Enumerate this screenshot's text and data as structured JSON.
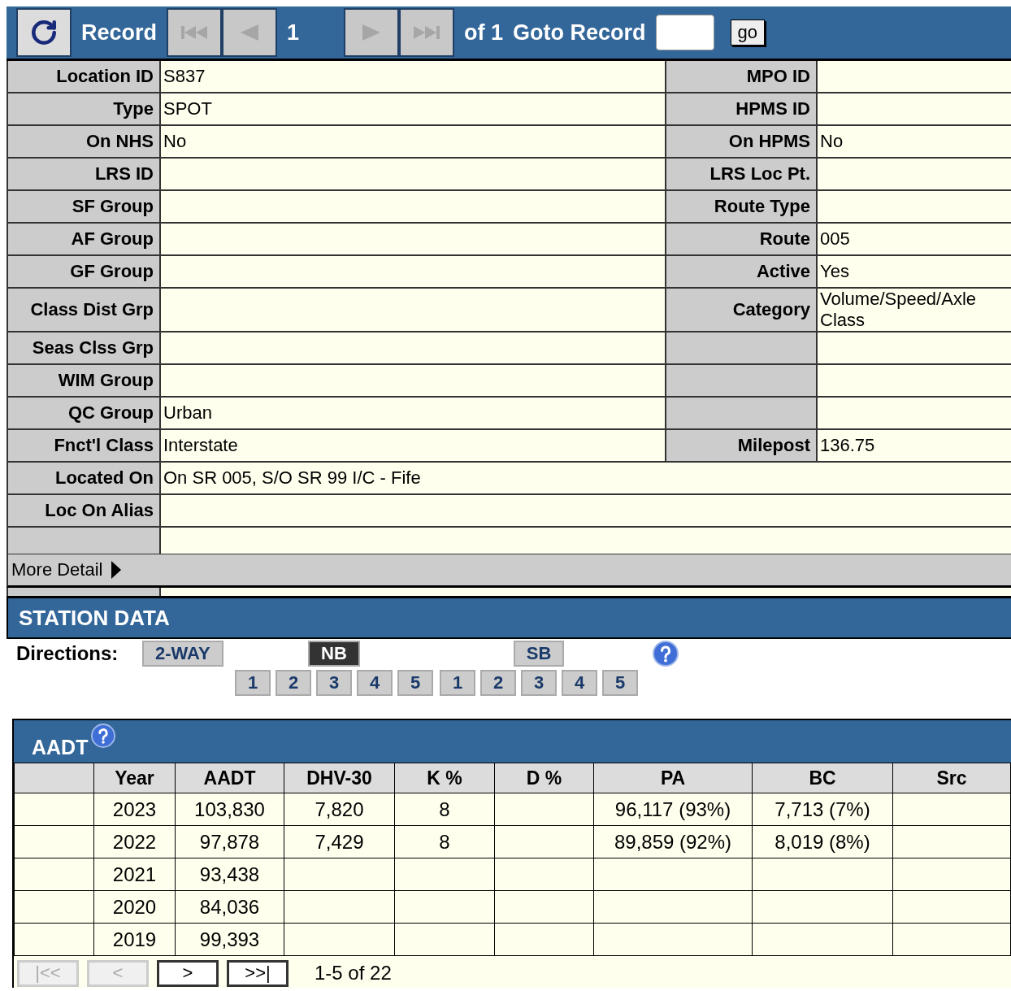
{
  "toolbar": {
    "buttons": [
      {
        "kind": "refresh",
        "disabled": false
      },
      {
        "kind": "first",
        "disabled": true
      },
      {
        "kind": "prev",
        "disabled": true
      },
      {
        "kind": "next",
        "disabled": true
      },
      {
        "kind": "last",
        "disabled": true
      }
    ],
    "record_label": "Record",
    "record": "1",
    "of": "of 1",
    "goto_label": "Goto Record",
    "go": "go"
  },
  "fields": [
    {
      "kind": "pair",
      "label": "Location ID",
      "value": "S837",
      "right": {
        "label": "MPO ID"
      }
    },
    {
      "kind": "pair",
      "label": "Type",
      "value": "SPOT",
      "right": {
        "label": "HPMS ID"
      }
    },
    {
      "kind": "pair",
      "label": "On NHS",
      "value": "No",
      "right": {
        "label": "On HPMS",
        "value": "No"
      }
    },
    {
      "kind": "pair",
      "label": "LRS ID",
      "right": {
        "label": "LRS Loc Pt."
      }
    },
    {
      "kind": "pair",
      "label": "SF Group",
      "right": {
        "label": "Route Type"
      }
    },
    {
      "kind": "pair",
      "label": "AF Group",
      "right": {
        "label": "Route",
        "value": "005"
      }
    },
    {
      "kind": "pair",
      "label": "GF Group",
      "right": {
        "label": "Active",
        "value": "Yes"
      }
    },
    {
      "kind": "pair",
      "label": "Class Dist Grp",
      "right": {
        "label": "Category",
        "value": "Volume/Speed/Axle Class"
      }
    },
    {
      "kind": "pair",
      "label": "Seas Clss Grp"
    },
    {
      "kind": "pair",
      "label": "WIM Group"
    },
    {
      "kind": "pair",
      "label": "QC Group",
      "value": "Urban"
    },
    {
      "kind": "pair",
      "label": "Fnct'l Class",
      "value": "Interstate",
      "right": {
        "label": "Milepost",
        "value": "136.75"
      }
    },
    {
      "kind": "wide",
      "label": "Located On",
      "value": "On SR 005, S/O SR 99 I/C - Fife"
    },
    {
      "kind": "wide",
      "label": "Loc On Alias"
    },
    {
      "kind": "blank"
    }
  ],
  "more_detail": "More Detail",
  "station": {
    "title": "STATION DATA",
    "directions_label": "Directions:",
    "directions": [
      {
        "label": "2-WAY",
        "selected": false
      },
      {
        "label": "NB",
        "selected": true,
        "lanes": [
          "1",
          "2",
          "3",
          "4",
          "5"
        ]
      },
      {
        "label": "SB",
        "selected": false,
        "lanes": [
          "1",
          "2",
          "3",
          "4",
          "5"
        ]
      }
    ]
  },
  "aadt": {
    "title": "AADT",
    "columns": [
      "Year",
      "AADT",
      "DHV-30",
      "K %",
      "D %",
      "PA",
      "BC",
      "Src"
    ],
    "rows": [
      [
        "2023",
        "103,830",
        "7,820",
        "8",
        "",
        "96,117 (93%)",
        "7,713 (7%)",
        ""
      ],
      [
        "2022",
        "97,878",
        "7,429",
        "8",
        "",
        "89,859 (92%)",
        "8,019 (8%)",
        ""
      ],
      [
        "2021",
        "93,438",
        "",
        "",
        "",
        "",
        "",
        ""
      ],
      [
        "2020",
        "84,036",
        "",
        "",
        "",
        "",
        "",
        ""
      ],
      [
        "2019",
        "99,393",
        "",
        "",
        "",
        "",
        "",
        ""
      ]
    ],
    "pager": [
      {
        "label": "|<<",
        "disabled": true
      },
      {
        "label": "<",
        "disabled": true
      },
      {
        "label": ">",
        "disabled": false
      },
      {
        "label": ">>|",
        "disabled": false
      }
    ],
    "range": "1-5 of 22"
  }
}
